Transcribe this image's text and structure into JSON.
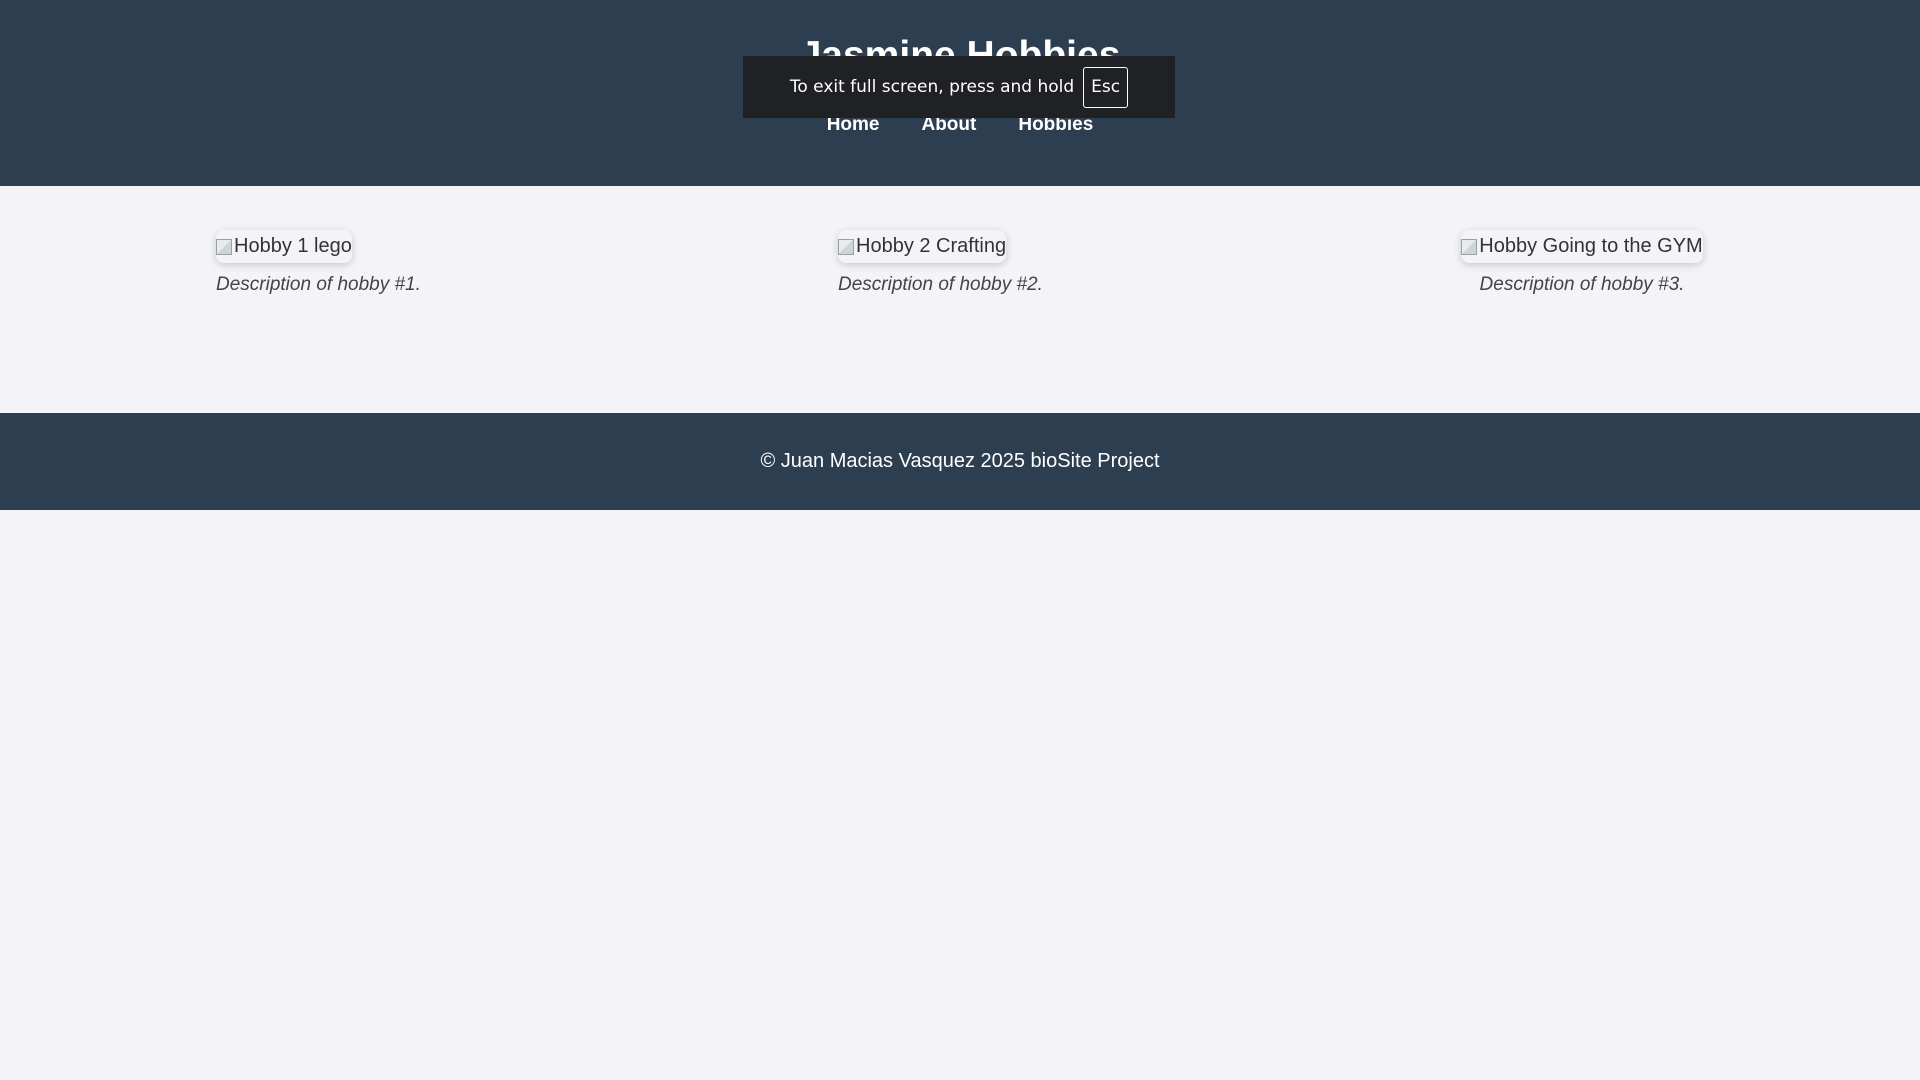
{
  "header": {
    "title": "Jasmine Hobbies",
    "nav": [
      {
        "label": "Home"
      },
      {
        "label": "About"
      },
      {
        "label": "Hobbies"
      }
    ]
  },
  "fullscreen_toast": {
    "message": "To exit full screen, press and hold",
    "key": "Esc"
  },
  "hobbies": [
    {
      "image_alt": "Hobby 1 lego",
      "description": "Description of hobby #1."
    },
    {
      "image_alt": "Hobby 2 Crafting",
      "description": "Description of hobby #2."
    },
    {
      "image_alt": "Hobby Going to the GYM",
      "description": "Description of hobby #3."
    }
  ],
  "footer": {
    "text": "© Juan Macias Vasquez 2025 bioSite Project"
  },
  "colors": {
    "header_bg": "#2e3e51",
    "page_bg": "#f4f4f8",
    "toast_bg": "#202124"
  }
}
